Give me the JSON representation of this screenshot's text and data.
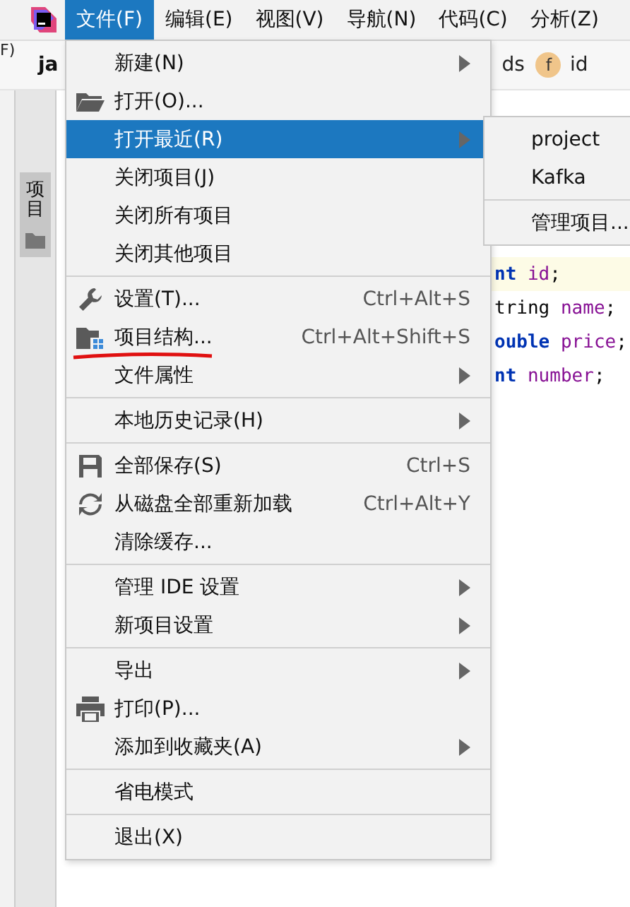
{
  "menubar": [
    {
      "label": "文件(F)",
      "selected": true
    },
    {
      "label": "编辑(E)",
      "selected": false
    },
    {
      "label": "视图(V)",
      "selected": false
    },
    {
      "label": "导航(N)",
      "selected": false
    },
    {
      "label": "代码(C)",
      "selected": false
    },
    {
      "label": "分析(Z)",
      "selected": false
    }
  ],
  "left_fragment": "F)",
  "tool_window": {
    "label": "项目"
  },
  "tab": {
    "label": "ja"
  },
  "breadcrumb": [
    {
      "label": "ds",
      "kind": "text"
    },
    {
      "label": "f",
      "kind": "badge"
    },
    {
      "label": "id",
      "kind": "text"
    }
  ],
  "code": [
    {
      "highlighted": true,
      "tokens": [
        {
          "text": "nt ",
          "kind": "keyword"
        },
        {
          "text": "id",
          "kind": "field"
        },
        {
          "text": ";",
          "kind": "plain"
        }
      ]
    },
    {
      "highlighted": false,
      "tokens": [
        {
          "text": "tring ",
          "kind": "plain"
        },
        {
          "text": "name",
          "kind": "field"
        },
        {
          "text": ";",
          "kind": "plain"
        }
      ]
    },
    {
      "highlighted": false,
      "tokens": [
        {
          "text": "ouble ",
          "kind": "keyword"
        },
        {
          "text": "price",
          "kind": "field"
        },
        {
          "text": ";",
          "kind": "plain"
        }
      ]
    },
    {
      "highlighted": false,
      "tokens": [
        {
          "text": "nt ",
          "kind": "keyword"
        },
        {
          "text": "number",
          "kind": "field"
        },
        {
          "text": ";",
          "kind": "plain"
        }
      ]
    }
  ],
  "menu": [
    {
      "kind": "item",
      "label": "新建(N)",
      "submenu": true,
      "selected": false
    },
    {
      "kind": "item",
      "label": "打开(O)...",
      "selected": false
    },
    {
      "kind": "item",
      "label": "打开最近(R)",
      "submenu": true,
      "selected": true
    },
    {
      "kind": "item",
      "label": "关闭项目(J)",
      "selected": false
    },
    {
      "kind": "item",
      "label": "关闭所有项目",
      "selected": false
    },
    {
      "kind": "item",
      "label": "关闭其他项目",
      "selected": false
    },
    {
      "kind": "separator"
    },
    {
      "kind": "item",
      "label": "设置(T)...",
      "shortcut": "Ctrl+Alt+S",
      "selected": false
    },
    {
      "kind": "item",
      "label": "项目结构...",
      "shortcut": "Ctrl+Alt+Shift+S",
      "selected": false,
      "marked": true
    },
    {
      "kind": "item",
      "label": "文件属性",
      "submenu": true,
      "selected": false
    },
    {
      "kind": "separator"
    },
    {
      "kind": "item",
      "label": "本地历史记录(H)",
      "submenu": true,
      "selected": false
    },
    {
      "kind": "separator"
    },
    {
      "kind": "item",
      "label": "全部保存(S)",
      "shortcut": "Ctrl+S",
      "selected": false
    },
    {
      "kind": "item",
      "label": "从磁盘全部重新加载",
      "shortcut": "Ctrl+Alt+Y",
      "selected": false
    },
    {
      "kind": "item",
      "label": "清除缓存...",
      "selected": false
    },
    {
      "kind": "separator"
    },
    {
      "kind": "item",
      "label": "管理 IDE 设置",
      "submenu": true,
      "selected": false
    },
    {
      "kind": "item",
      "label": "新项目设置",
      "submenu": true,
      "selected": false
    },
    {
      "kind": "separator"
    },
    {
      "kind": "item",
      "label": "导出",
      "submenu": true,
      "selected": false
    },
    {
      "kind": "item",
      "label": "打印(P)...",
      "selected": false
    },
    {
      "kind": "item",
      "label": "添加到收藏夹(A)",
      "submenu": true,
      "selected": false
    },
    {
      "kind": "separator"
    },
    {
      "kind": "item",
      "label": "省电模式",
      "selected": false
    },
    {
      "kind": "separator"
    },
    {
      "kind": "item",
      "label": "退出(X)",
      "selected": false
    }
  ],
  "recent_submenu": [
    {
      "kind": "item",
      "label": "project"
    },
    {
      "kind": "item",
      "label": "Kafka"
    },
    {
      "kind": "separator"
    },
    {
      "kind": "item",
      "label": "管理项目..."
    }
  ]
}
